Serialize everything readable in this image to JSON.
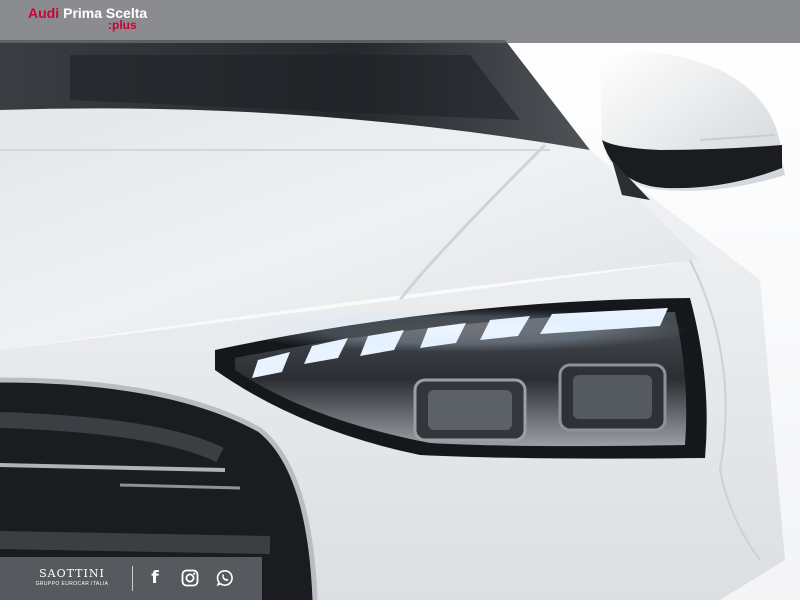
{
  "header": {
    "brand_audi": "Audi",
    "brand_prima": "Prima Scelta",
    "brand_plus": ":plus"
  },
  "footer": {
    "dealer_name": "SAOTTINI",
    "dealer_subtitle": "GRUPPO EUROCAR ITALIA",
    "social": [
      {
        "name": "facebook-icon",
        "glyph": "f"
      },
      {
        "name": "instagram-icon"
      },
      {
        "name": "whatsapp-icon"
      }
    ]
  },
  "colors": {
    "accent": "#cc0033",
    "bar_overlay": "#696c70",
    "car_body": "#eef0f2"
  }
}
